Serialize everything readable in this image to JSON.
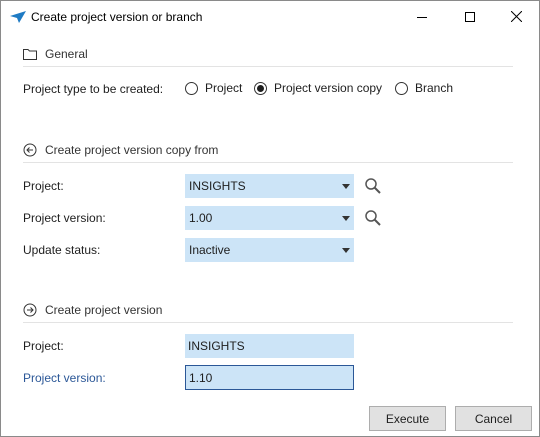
{
  "window": {
    "title": "Create project version or branch"
  },
  "general": {
    "header": "General",
    "project_type_label": "Project type to be created:",
    "options": [
      {
        "label": "Project",
        "selected": false
      },
      {
        "label": "Project version copy",
        "selected": true
      },
      {
        "label": "Branch",
        "selected": false
      }
    ]
  },
  "copy_from": {
    "header": "Create project version copy from",
    "project_label": "Project:",
    "project_value": "INSIGHTS",
    "version_label": "Project version:",
    "version_value": "1.00",
    "status_label": "Update status:",
    "status_value": "Inactive"
  },
  "create_version": {
    "header": "Create project version",
    "project_label": "Project:",
    "project_value": "INSIGHTS",
    "version_label": "Project version:",
    "version_value": "1.10"
  },
  "buttons": {
    "execute": "Execute",
    "cancel": "Cancel"
  },
  "colors": {
    "field_background": "#cce4f7",
    "accent_label": "#2b5797"
  }
}
